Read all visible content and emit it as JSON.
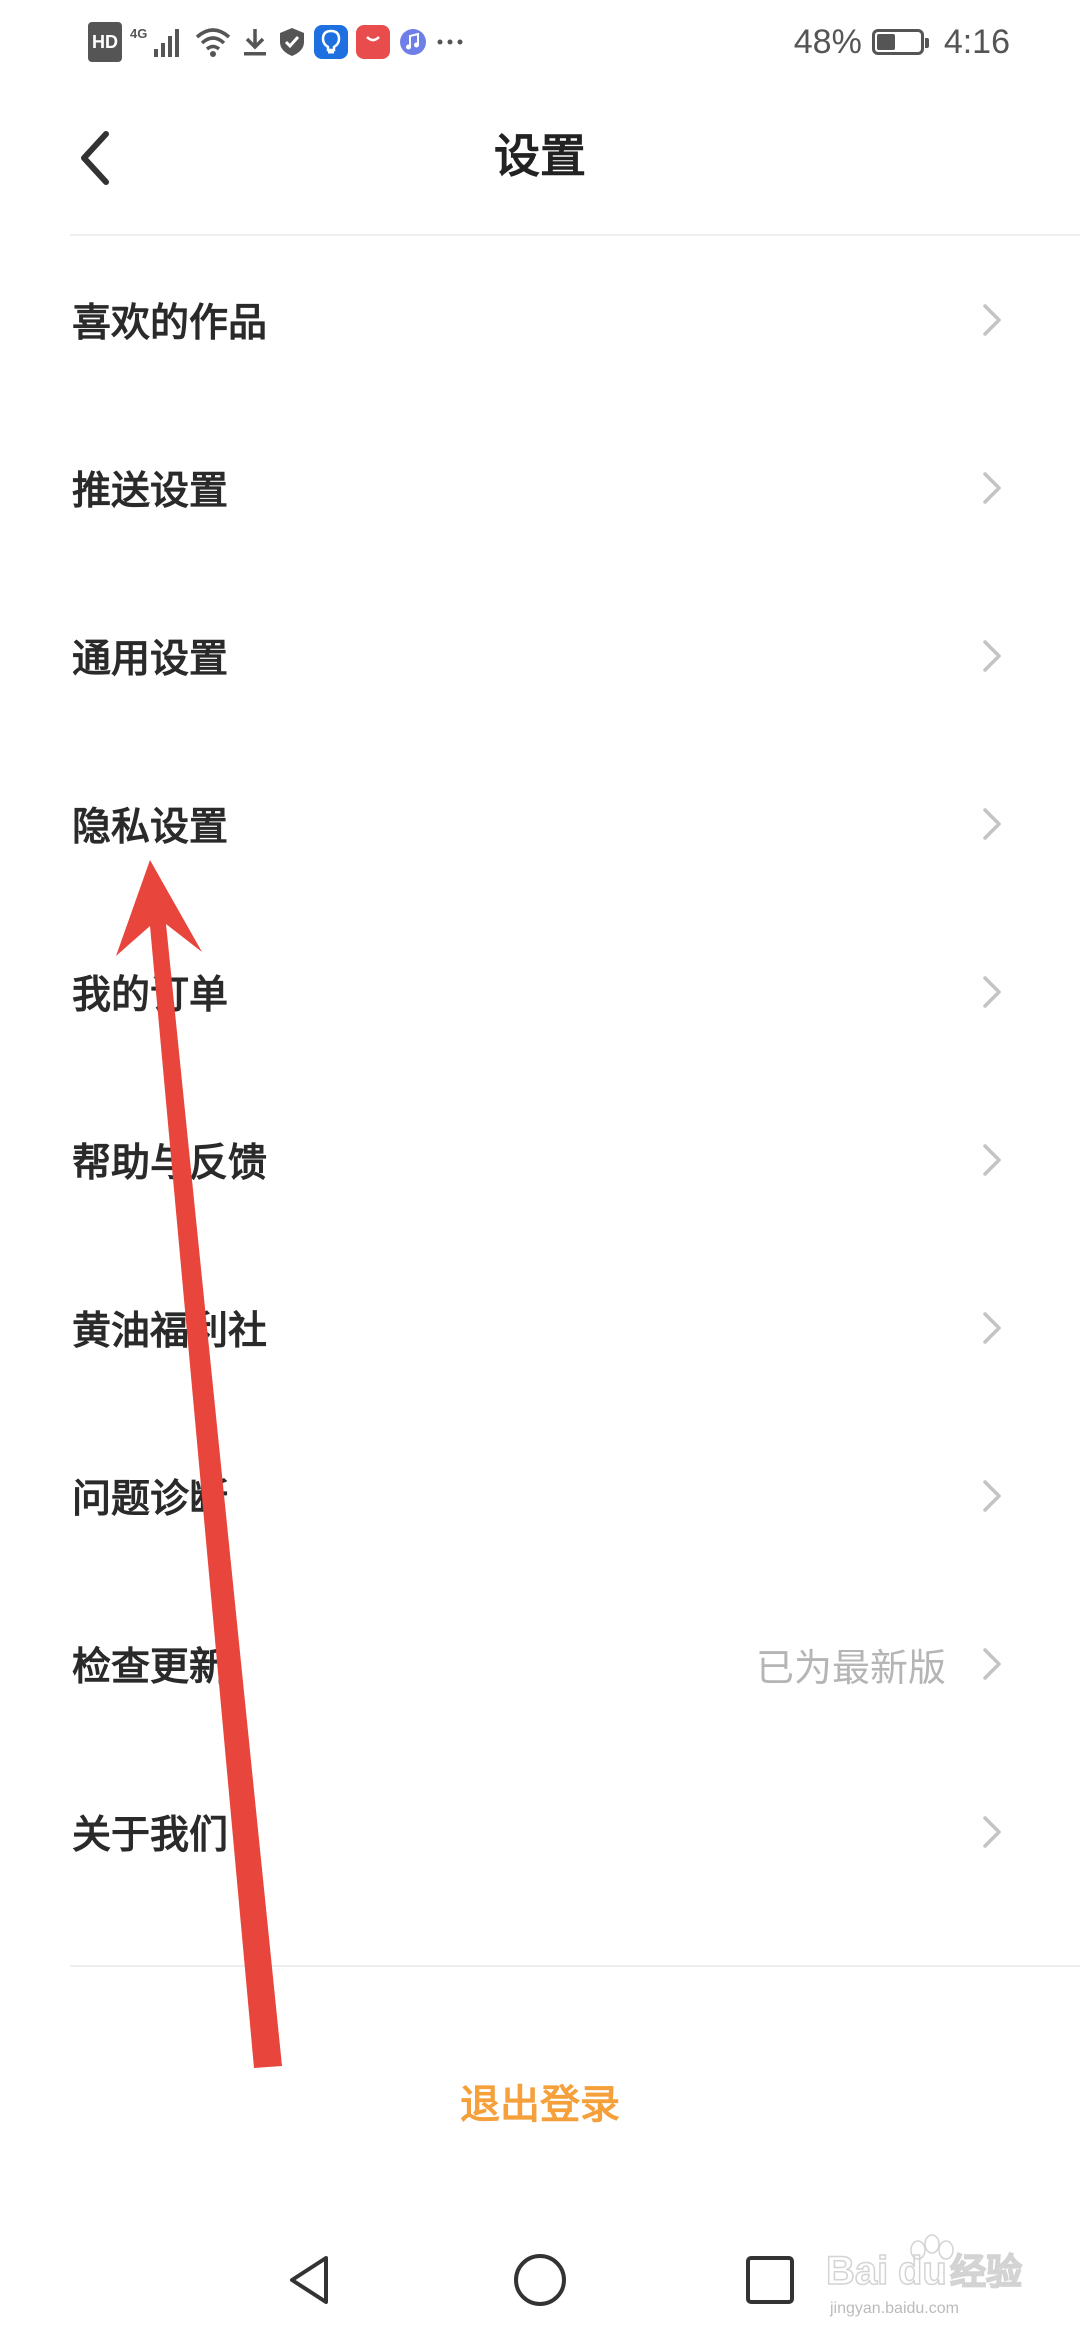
{
  "status_bar": {
    "hd": "HD",
    "network": "4G",
    "battery_percent": "48%",
    "battery_level": 0.48,
    "time": "4:16"
  },
  "header": {
    "title": "设置",
    "back_icon": "chevron-left-icon"
  },
  "menu": {
    "items": [
      {
        "label": "喜欢的作品",
        "value": ""
      },
      {
        "label": "推送设置",
        "value": ""
      },
      {
        "label": "通用设置",
        "value": ""
      },
      {
        "label": "隐私设置",
        "value": ""
      },
      {
        "label": "我的订单",
        "value": ""
      },
      {
        "label": "帮助与反馈",
        "value": ""
      },
      {
        "label": "黄油福利社",
        "value": ""
      },
      {
        "label": "问题诊断",
        "value": ""
      },
      {
        "label": "检查更新",
        "value": "已为最新版"
      },
      {
        "label": "关于我们",
        "value": ""
      }
    ]
  },
  "logout": {
    "label": "退出登录"
  },
  "nav_bar": {
    "back_icon": "triangle-back-icon",
    "home_icon": "circle-home-icon",
    "recents_icon": "square-recents-icon"
  },
  "watermark": {
    "text": "jingyan.baidu.com"
  },
  "colors": {
    "accent": "#f5a03a",
    "arrow": "#e8453c",
    "text": "#2a2a2a",
    "secondary_text": "#b5b5b5"
  }
}
